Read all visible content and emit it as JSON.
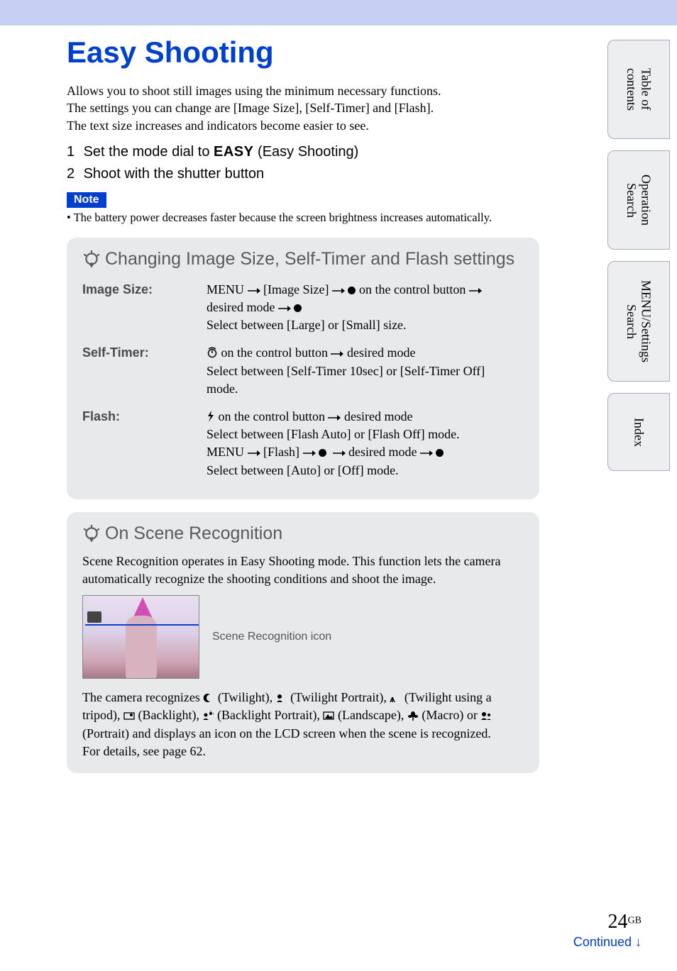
{
  "page_title": "Easy Shooting",
  "intro": "Allows you to shoot still images using the minimum necessary functions.\nThe settings you can change are [Image Size], [Self-Timer] and [Flash].\nThe text size increases and indicators become easier to see.",
  "steps": [
    {
      "num": "1",
      "pre": "Set the mode dial to ",
      "icon": "EASY",
      "post": " (Easy Shooting)"
    },
    {
      "num": "2",
      "pre": "Shoot with the shutter button",
      "icon": "",
      "post": ""
    }
  ],
  "note": {
    "label": "Note",
    "text": "•  The battery power decreases faster because the screen brightness increases automatically."
  },
  "panel1": {
    "title": "Changing Image Size, Self-Timer and Flash settings",
    "rows": {
      "image_size": {
        "label": "Image Size:",
        "line1a": "MENU ",
        "line1b": " [Image Size] ",
        "line1c": " ",
        "line1d": " on the control button ",
        "line1e": " desired mode ",
        "line2": "Select between [Large] or [Small] size."
      },
      "self_timer": {
        "label": "Self-Timer:",
        "line1b": " on the control button ",
        "line1c": " desired mode",
        "line2": "Select between [Self-Timer 10sec] or [Self-Timer Off] mode."
      },
      "flash": {
        "label": "Flash:",
        "line1b": " on the control button ",
        "line1c": " desired mode",
        "line2": "Select between [Flash Auto] or [Flash Off] mode.",
        "line3a": "MENU ",
        "line3b": " [Flash] ",
        "line3d": " desired mode ",
        "line4": "Select between [Auto] or [Off] mode."
      }
    }
  },
  "panel2": {
    "title": "On Scene Recognition",
    "intro": "Scene Recognition operates in Easy Shooting mode. This function lets the camera automatically recognize the shooting conditions and shoot the image.",
    "caption": "Scene Recognition icon",
    "body_pre": "The camera recognizes ",
    "scenes": [
      " (Twilight), ",
      " (Twilight Portrait), ",
      " (Twilight using a tripod), ",
      " (Backlight), ",
      " (Backlight Portrait), ",
      " (Landscape), ",
      " (Macro) or ",
      " (Portrait) and "
    ],
    "body_post": "displays an icon on the LCD screen when the scene is recognized.\nFor details, see page 62."
  },
  "tabs": {
    "toc": "Table of\ncontents",
    "op": "Operation\nSearch",
    "menu": "MENU/Settings\nSearch",
    "index": "Index"
  },
  "footer": {
    "continued": "Continued ",
    "page": "24",
    "gb": "GB"
  }
}
